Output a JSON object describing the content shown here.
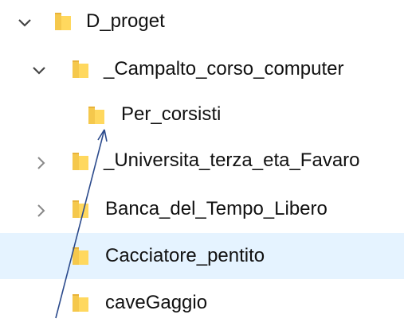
{
  "tree": {
    "items": [
      {
        "label": "D_proget",
        "chevron": "chevron-down-icon",
        "expanded": true
      },
      {
        "label": "_Campalto_corso_computer",
        "chevron": "chevron-down-icon",
        "expanded": true
      },
      {
        "label": "Per_corsisti"
      },
      {
        "label": "_Universita_terza_eta_Favaro",
        "chevron": "chevron-right-icon",
        "expanded": false
      },
      {
        "label": "Banca_del_Tempo_Libero",
        "chevron": "chevron-right-icon",
        "expanded": false
      },
      {
        "label": "Cacciatore_pentito",
        "selected": true
      },
      {
        "label": "caveGaggio"
      }
    ]
  },
  "colors": {
    "folder_body": "#f5c84c",
    "folder_front": "#ffd85e",
    "folder_tab": "#e8b33a",
    "selection": "#e5f3ff",
    "chevron": "#444444",
    "arrow": "#2b4a8c"
  }
}
